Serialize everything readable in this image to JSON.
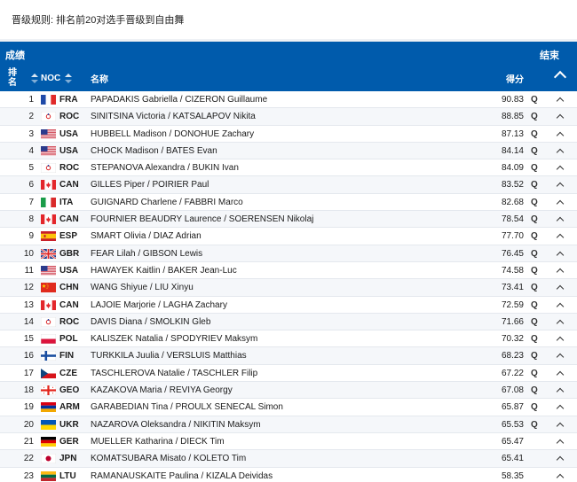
{
  "note": "晋级规则: 排名前20对选手晋级到自由舞",
  "panel": {
    "title": "成绩",
    "status": "结束"
  },
  "columns": {
    "rank": "排名",
    "noc": "NOC",
    "name": "名称",
    "score": "得分"
  },
  "rows": [
    {
      "rank": "1",
      "noc": "FRA",
      "name": "PAPADAKIS Gabriella / CIZERON Guillaume",
      "score": "90.83",
      "q": "Q",
      "flag": "fra-flag-icon"
    },
    {
      "rank": "2",
      "noc": "ROC",
      "name": "SINITSINA Victoria / KATSALAPOV Nikita",
      "score": "88.85",
      "q": "Q",
      "flag": "roc-flag-icon"
    },
    {
      "rank": "3",
      "noc": "USA",
      "name": "HUBBELL Madison / DONOHUE Zachary",
      "score": "87.13",
      "q": "Q",
      "flag": "usa-flag-icon"
    },
    {
      "rank": "4",
      "noc": "USA",
      "name": "CHOCK Madison / BATES Evan",
      "score": "84.14",
      "q": "Q",
      "flag": "usa-flag-icon"
    },
    {
      "rank": "5",
      "noc": "ROC",
      "name": "STEPANOVA Alexandra / BUKIN Ivan",
      "score": "84.09",
      "q": "Q",
      "flag": "roc-flag-icon"
    },
    {
      "rank": "6",
      "noc": "CAN",
      "name": "GILLES Piper / POIRIER Paul",
      "score": "83.52",
      "q": "Q",
      "flag": "can-flag-icon"
    },
    {
      "rank": "7",
      "noc": "ITA",
      "name": "GUIGNARD Charlene / FABBRI Marco",
      "score": "82.68",
      "q": "Q",
      "flag": "ita-flag-icon"
    },
    {
      "rank": "8",
      "noc": "CAN",
      "name": "FOURNIER BEAUDRY Laurence / SOERENSEN Nikolaj",
      "score": "78.54",
      "q": "Q",
      "flag": "can-flag-icon"
    },
    {
      "rank": "9",
      "noc": "ESP",
      "name": "SMART Olivia / DIAZ Adrian",
      "score": "77.70",
      "q": "Q",
      "flag": "esp-flag-icon"
    },
    {
      "rank": "10",
      "noc": "GBR",
      "name": "FEAR Lilah / GIBSON Lewis",
      "score": "76.45",
      "q": "Q",
      "flag": "gbr-flag-icon"
    },
    {
      "rank": "11",
      "noc": "USA",
      "name": "HAWAYEK Kaitlin / BAKER Jean-Luc",
      "score": "74.58",
      "q": "Q",
      "flag": "usa-flag-icon"
    },
    {
      "rank": "12",
      "noc": "CHN",
      "name": "WANG Shiyue / LIU Xinyu",
      "score": "73.41",
      "q": "Q",
      "flag": "chn-flag-icon"
    },
    {
      "rank": "13",
      "noc": "CAN",
      "name": "LAJOIE Marjorie / LAGHA Zachary",
      "score": "72.59",
      "q": "Q",
      "flag": "can-flag-icon"
    },
    {
      "rank": "14",
      "noc": "ROC",
      "name": "DAVIS Diana / SMOLKIN Gleb",
      "score": "71.66",
      "q": "Q",
      "flag": "roc-flag-icon"
    },
    {
      "rank": "15",
      "noc": "POL",
      "name": "KALISZEK Natalia / SPODYRIEV Maksym",
      "score": "70.32",
      "q": "Q",
      "flag": "pol-flag-icon"
    },
    {
      "rank": "16",
      "noc": "FIN",
      "name": "TURKKILA Juulia / VERSLUIS Matthias",
      "score": "68.23",
      "q": "Q",
      "flag": "fin-flag-icon"
    },
    {
      "rank": "17",
      "noc": "CZE",
      "name": "TASCHLEROVA Natalie / TASCHLER Filip",
      "score": "67.22",
      "q": "Q",
      "flag": "cze-flag-icon"
    },
    {
      "rank": "18",
      "noc": "GEO",
      "name": "KAZAKOVA Maria / REVIYA Georgy",
      "score": "67.08",
      "q": "Q",
      "flag": "geo-flag-icon"
    },
    {
      "rank": "19",
      "noc": "ARM",
      "name": "GARABEDIAN Tina / PROULX SENECAL Simon",
      "score": "65.87",
      "q": "Q",
      "flag": "arm-flag-icon"
    },
    {
      "rank": "20",
      "noc": "UKR",
      "name": "NAZAROVA Oleksandra / NIKITIN Maksym",
      "score": "65.53",
      "q": "Q",
      "flag": "ukr-flag-icon"
    },
    {
      "rank": "21",
      "noc": "GER",
      "name": "MUELLER Katharina / DIECK Tim",
      "score": "65.47",
      "q": "",
      "flag": "ger-flag-icon"
    },
    {
      "rank": "22",
      "noc": "JPN",
      "name": "KOMATSUBARA Misato / KOLETO Tim",
      "score": "65.41",
      "q": "",
      "flag": "jpn-flag-icon"
    },
    {
      "rank": "23",
      "noc": "LTU",
      "name": "RAMANAUSKAITE Paulina / KIZALA Deividas",
      "score": "58.35",
      "q": "",
      "flag": "ltu-flag-icon"
    }
  ],
  "colors": {
    "header_bg": "#005bac",
    "page_bg": "#eef1f5",
    "row_alt": "#f5f7fa"
  }
}
